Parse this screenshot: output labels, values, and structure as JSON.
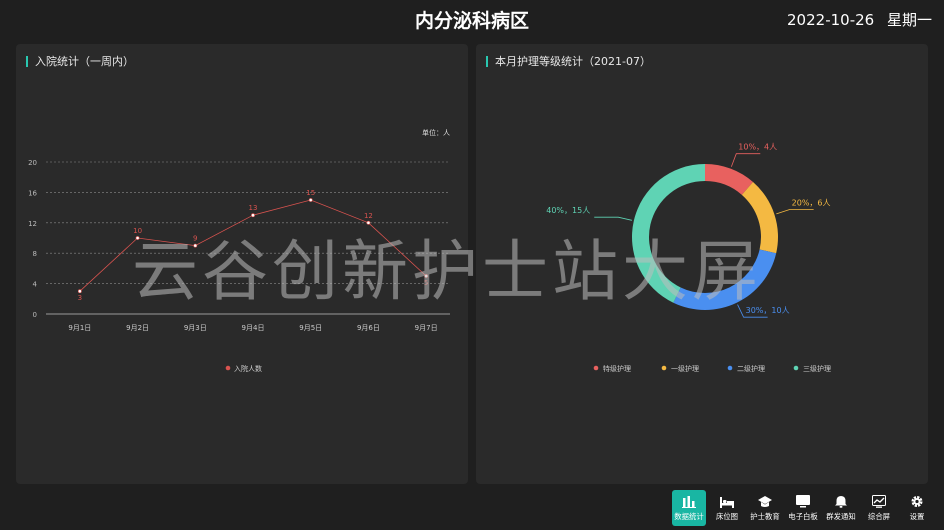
{
  "header": {
    "title": "内分泌科病区",
    "date": "2022-10-26",
    "weekday": "星期一"
  },
  "left_panel": {
    "title": "入院统计（一周内）",
    "unit": "单位：人",
    "legend": "入院人数"
  },
  "right_panel": {
    "title": "本月护理等级统计（2021-07）"
  },
  "watermark": "云谷创新护士站大屏",
  "colors": {
    "accent": "#19b6a3",
    "line": "#d9534f"
  },
  "chart_data": [
    {
      "type": "line",
      "categories": [
        "9月1日",
        "9月2日",
        "9月3日",
        "9月4日",
        "9月5日",
        "9月6日",
        "9月7日"
      ],
      "series": [
        {
          "name": "入院人数",
          "values": [
            3,
            10,
            9,
            13,
            15,
            12,
            5
          ]
        }
      ],
      "ylim": [
        0,
        20
      ],
      "yticks": [
        0,
        4,
        8,
        12,
        16,
        20
      ],
      "grid": true,
      "legend_position": "bottom"
    },
    {
      "type": "pie",
      "donut": true,
      "legend_position": "bottom",
      "slices": [
        {
          "name": "特级护理",
          "value": 4,
          "percent": "10%",
          "label": "10%，4人",
          "color": "#e8615f"
        },
        {
          "name": "一级护理",
          "value": 6,
          "percent": "20%",
          "label": "20%，6人",
          "color": "#f4b942"
        },
        {
          "name": "二级护理",
          "value": 10,
          "percent": "30%",
          "label": "30%，10人",
          "color": "#4a8ff0"
        },
        {
          "name": "三级护理",
          "value": 15,
          "percent": "40%",
          "label": "40%，15人",
          "color": "#5fd3b4"
        }
      ]
    }
  ],
  "navbar": {
    "items": [
      {
        "label": "数据统计",
        "icon": "bar-chart-icon",
        "active": true
      },
      {
        "label": "床位图",
        "icon": "bed-icon",
        "active": false
      },
      {
        "label": "护士教育",
        "icon": "graduation-cap-icon",
        "active": false
      },
      {
        "label": "电子白板",
        "icon": "monitor-icon",
        "active": false
      },
      {
        "label": "群发通知",
        "icon": "bell-icon",
        "active": false
      },
      {
        "label": "综合屏",
        "icon": "trend-chart-icon",
        "active": false
      },
      {
        "label": "设置",
        "icon": "gear-icon",
        "active": false
      }
    ]
  }
}
